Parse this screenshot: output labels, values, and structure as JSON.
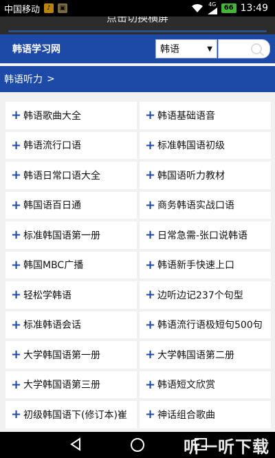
{
  "status_bar": {
    "carrier": "中国移动",
    "network": "4G",
    "battery": "66",
    "time": "13:49"
  },
  "hint_bar": {
    "text": "点击切换横屏"
  },
  "header": {
    "site_name": "韩语学习网",
    "language_select": "韩语",
    "search_placeholder": ""
  },
  "breadcrumb": {
    "current": "韩语听力",
    "separator": ">"
  },
  "items": [
    "韩语歌曲大全",
    "韩语基础语音",
    "韩语流行口语",
    "标准韩国语初级",
    "韩语日常口语大全",
    "韩国语听力教材",
    "韩国语百日通",
    "商务韩语实战口语",
    "标准韩国语第一册",
    "日常急需-张口说韩语",
    "韩国MBC广播",
    "韩语新手快速上口",
    "轻松学韩语",
    "边听边记237个句型",
    "标准韩语会话",
    "韩语流行语极短句500句",
    "大学韩国语第一册",
    "大学韩国语第二册",
    "大学韩国语第三册",
    "韩语短文欣赏",
    "初级韩国语下(修订本)崔",
    "神话组合歌曲"
  ],
  "watermark": "听一听下载",
  "colors": {
    "brand_blue": "#1d4aa6",
    "background": "#f1f1f1"
  }
}
